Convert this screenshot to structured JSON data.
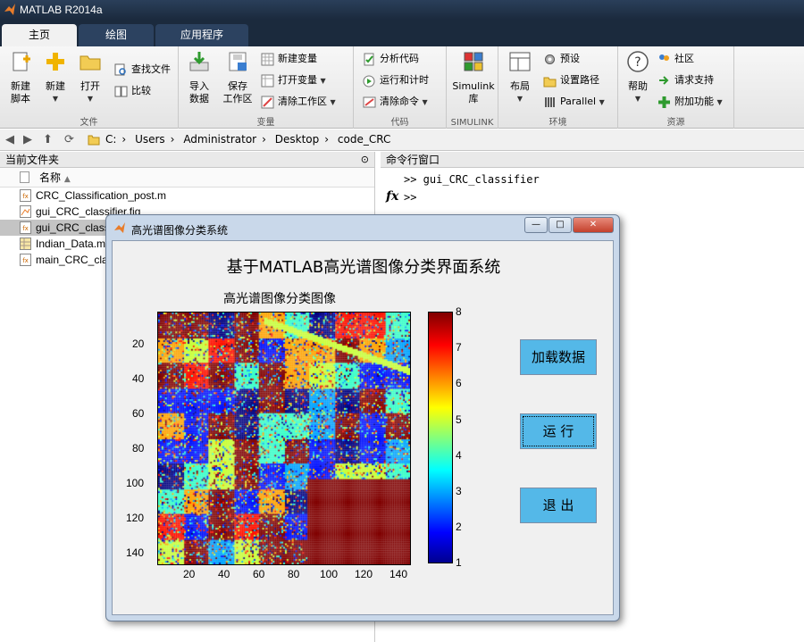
{
  "window": {
    "title": "MATLAB R2014a"
  },
  "tabs": [
    "主页",
    "绘图",
    "应用程序"
  ],
  "ribbon": {
    "groups": {
      "file": "文件",
      "variable": "变量",
      "code": "代码",
      "simulink": "SIMULINK",
      "environment": "环境",
      "resources": "资源"
    },
    "new_script": "新建\n脚本",
    "new": "新建",
    "open": "打开",
    "find_files": "查找文件",
    "compare": "比较",
    "import_data": "导入\n数据",
    "save_workspace": "保存\n工作区",
    "new_variable": "新建变量",
    "open_variable": "打开变量",
    "clear_workspace": "清除工作区",
    "analyze_code": "分析代码",
    "run_and_time": "运行和计时",
    "clear_commands": "清除命令",
    "simulink_lib": "Simulink\n库",
    "layout": "布局",
    "preferences": "预设",
    "set_path": "设置路径",
    "parallel": "Parallel",
    "help": "帮助",
    "community": "社区",
    "request_support": "请求支持",
    "add_ons": "附加功能"
  },
  "address": {
    "crumbs": [
      "C:",
      "Users",
      "Administrator",
      "Desktop",
      "code_CRC"
    ]
  },
  "current_folder": {
    "title": "当前文件夹",
    "column_name": "名称",
    "files": [
      "CRC_Classification_post.m",
      "gui_CRC_classifier.fig",
      "gui_CRC_classifier.m",
      "Indian_Data.mat",
      "main_CRC_classifier.m"
    ]
  },
  "command_window": {
    "title": "命令行窗口",
    "lines": [
      ">>  gui_CRC_classifier",
      ">>"
    ],
    "fx": "fx"
  },
  "dialog": {
    "title": "高光谱图像分类系统",
    "heading": "基于MATLAB高光谱图像分类界面系统",
    "plot_title": "高光谱图像分类图像",
    "buttons": {
      "load": "加载数据",
      "run": "运 行",
      "exit": "退 出"
    },
    "yticks": [
      "20",
      "40",
      "60",
      "80",
      "100",
      "120",
      "140"
    ],
    "xticks": [
      "20",
      "40",
      "60",
      "80",
      "100",
      "120",
      "140"
    ],
    "cticks": [
      "8",
      "7",
      "6",
      "5",
      "4",
      "3",
      "2",
      "1"
    ]
  },
  "colors": {
    "ribbon_dark": "#1b2a3d",
    "button_blue": "#54b8e8",
    "dialog_frame": "#c9d8ea"
  },
  "chart_data": {
    "type": "heatmap",
    "title": "高光谱图像分类图像",
    "xlim": [
      1,
      145
    ],
    "ylim": [
      1,
      145
    ],
    "x_ticks": [
      20,
      40,
      60,
      80,
      100,
      120,
      140
    ],
    "y_ticks": [
      20,
      40,
      60,
      80,
      100,
      120,
      140
    ],
    "colorbar": {
      "min": 1,
      "max": 8,
      "ticks": [
        1,
        2,
        3,
        4,
        5,
        6,
        7,
        8
      ],
      "colormap": "jet"
    }
  }
}
